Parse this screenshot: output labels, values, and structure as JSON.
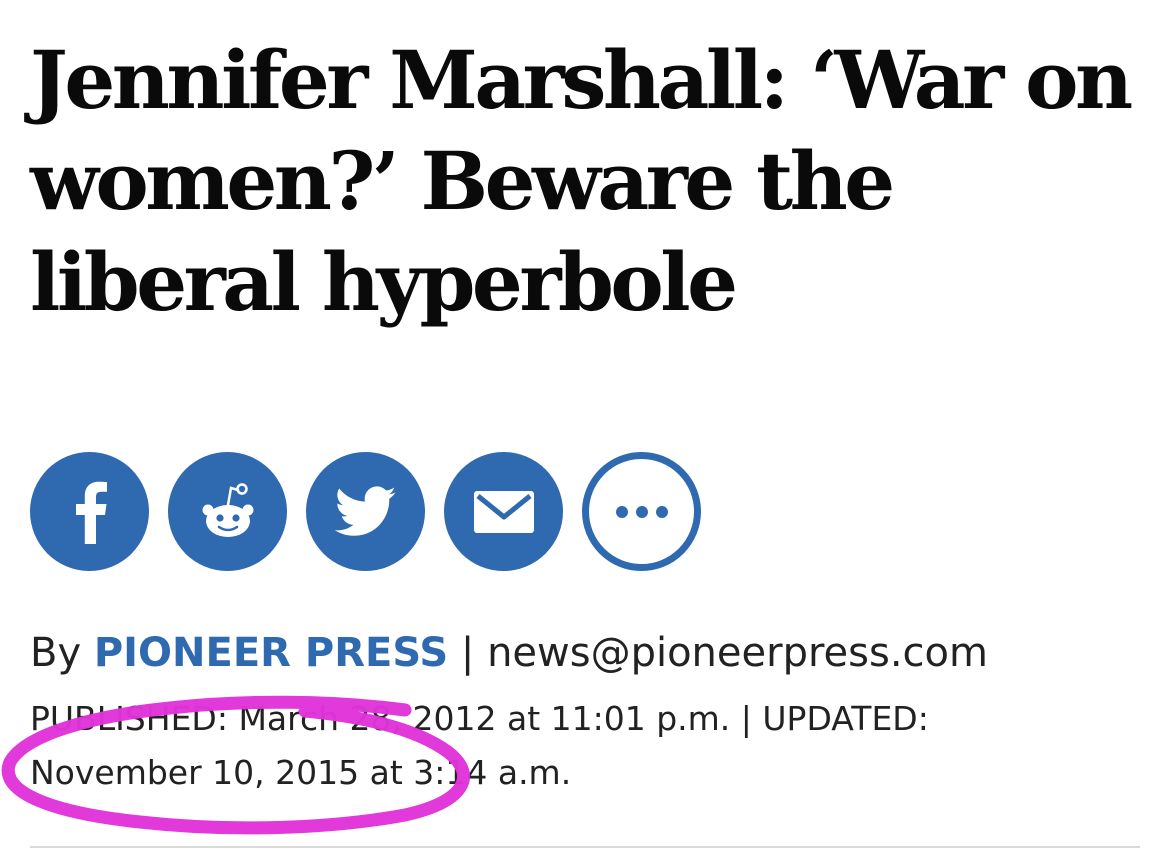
{
  "article": {
    "headline": "Jennifer Marshall: ‘War on women?’ Beware the liberal hyperbole",
    "byline": {
      "prefix": "By ",
      "author": "PIONEER PRESS",
      "separator": " | ",
      "email": "news@pioneerpress.com"
    },
    "published_label": "PUBLISHED:",
    "published_value": "March 28, 2012 at 11:01 p.m.",
    "date_separator": " | ",
    "updated_label": "UPDATED:",
    "updated_value": "November 10, 2015 at 3:14 a.m."
  },
  "share_buttons": [
    {
      "icon": "facebook-icon"
    },
    {
      "icon": "reddit-icon"
    },
    {
      "icon": "twitter-icon"
    },
    {
      "icon": "email-icon"
    },
    {
      "icon": "more-icon"
    }
  ],
  "colors": {
    "accent": "#2f69b0",
    "annotation": "#e033d9",
    "text": "#222222"
  }
}
